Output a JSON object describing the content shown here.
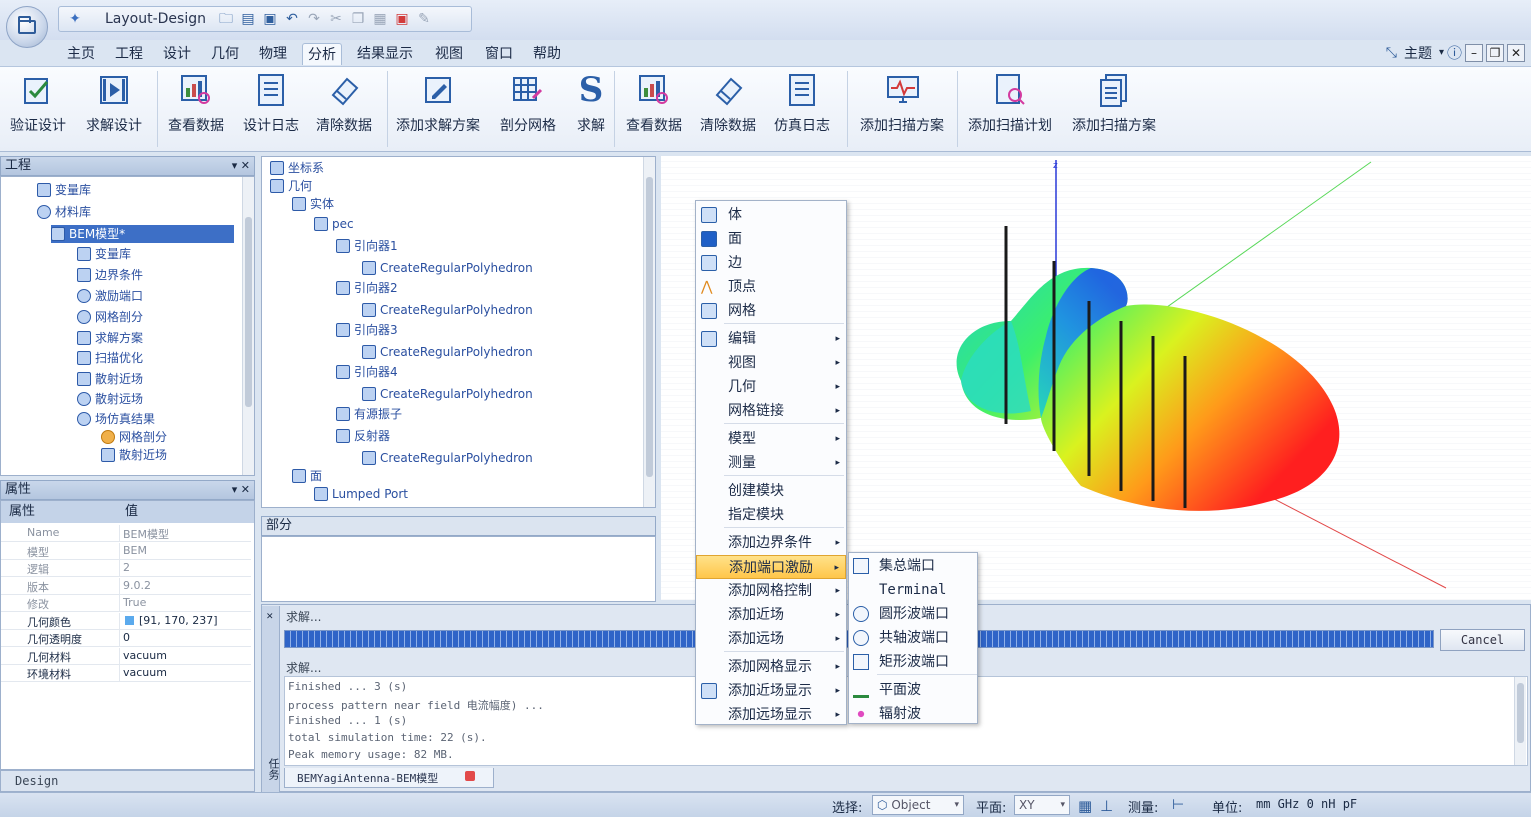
{
  "app": {
    "title": "Layout-Design"
  },
  "menus": [
    "主页",
    "工程",
    "设计",
    "几何",
    "物理",
    "分析",
    "结果显示",
    "视图",
    "窗口",
    "帮助"
  ],
  "menu_active": "分析",
  "theme_label": "主题",
  "ribbon": {
    "buttons": [
      "验证设计",
      "求解设计",
      "查看数据",
      "设计日志",
      "清除数据",
      "添加求解方案",
      "剖分网格",
      "求解",
      "查看数据",
      "清除数据",
      "仿真日志",
      "添加扫描方案",
      "添加扫描计划",
      "添加扫描方案"
    ]
  },
  "project_panel": {
    "title": "工程",
    "items": [
      "变量库",
      "材料库",
      "BEM模型*",
      "变量库",
      "边界条件",
      "激励端口",
      "网格剖分",
      "求解方案",
      "扫描优化",
      "散射近场",
      "散射远场",
      "场仿真结果",
      "网格剖分",
      "散射近场"
    ]
  },
  "geometry_tree": {
    "items": [
      "坐标系",
      "几何",
      "实体",
      "pec",
      "引向器1",
      "CreateRegularPolyhedron",
      "引向器2",
      "CreateRegularPolyhedron",
      "引向器3",
      "CreateRegularPolyhedron",
      "引向器4",
      "CreateRegularPolyhedron",
      "有源振子",
      "反射器",
      "CreateRegularPolyhedron",
      "面",
      "Lumped Port"
    ]
  },
  "parts_panel": {
    "title": "部分"
  },
  "properties": {
    "title": "属性",
    "col_key": "属性",
    "col_val": "值",
    "rows": [
      {
        "k": "Name",
        "v": "BEM模型",
        "bold": false
      },
      {
        "k": "模型",
        "v": "BEM",
        "bold": false
      },
      {
        "k": "逻辑",
        "v": "2",
        "bold": false
      },
      {
        "k": "版本",
        "v": "9.0.2",
        "bold": false
      },
      {
        "k": "修改",
        "v": "True",
        "bold": false
      },
      {
        "k": "几何颜色",
        "v": "[91, 170, 237]",
        "bold": true
      },
      {
        "k": "几何透明度",
        "v": "0",
        "bold": true
      },
      {
        "k": "几何材料",
        "v": "vacuum",
        "bold": true
      },
      {
        "k": "环境材料",
        "v": "vacuum",
        "bold": true
      }
    ],
    "geom_color": "#5baaed"
  },
  "left_tab": "Design",
  "context_menu": {
    "items": [
      "体",
      "面",
      "边",
      "顶点",
      "网格",
      "编辑",
      "视图",
      "几何",
      "网格链接",
      "模型",
      "测量",
      "创建模块",
      "指定模块",
      "添加边界条件",
      "添加端口激励",
      "添加网格控制",
      "添加近场",
      "添加远场",
      "添加网格显示",
      "添加近场显示",
      "添加远场显示"
    ],
    "highlighted": "添加端口激励"
  },
  "submenu": {
    "items": [
      "集总端口",
      "Terminal",
      "圆形波端口",
      "共轴波端口",
      "矩形波端口",
      "平面波",
      "辐射波"
    ]
  },
  "solve": {
    "label1": "求解...",
    "label2": "求解...",
    "cancel": "Cancel",
    "log": [
      "Finished ... 3 (s)",
      "process pattern near field 电流幅度) ...",
      "Finished ... 1 (s)",
      "total simulation time: 22 (s).",
      "Peak memory usage: 82 MB."
    ],
    "doc_tab": "BEMYagiAntenna-BEM模型",
    "side_tab": "任务"
  },
  "status": {
    "select_label": "选择:",
    "select_value": "Object",
    "plane_label": "平面:",
    "plane_value": "XY",
    "measure_label": "测量:",
    "unit_label": "单位:",
    "units": "mm  GHz 0 nH pF"
  }
}
